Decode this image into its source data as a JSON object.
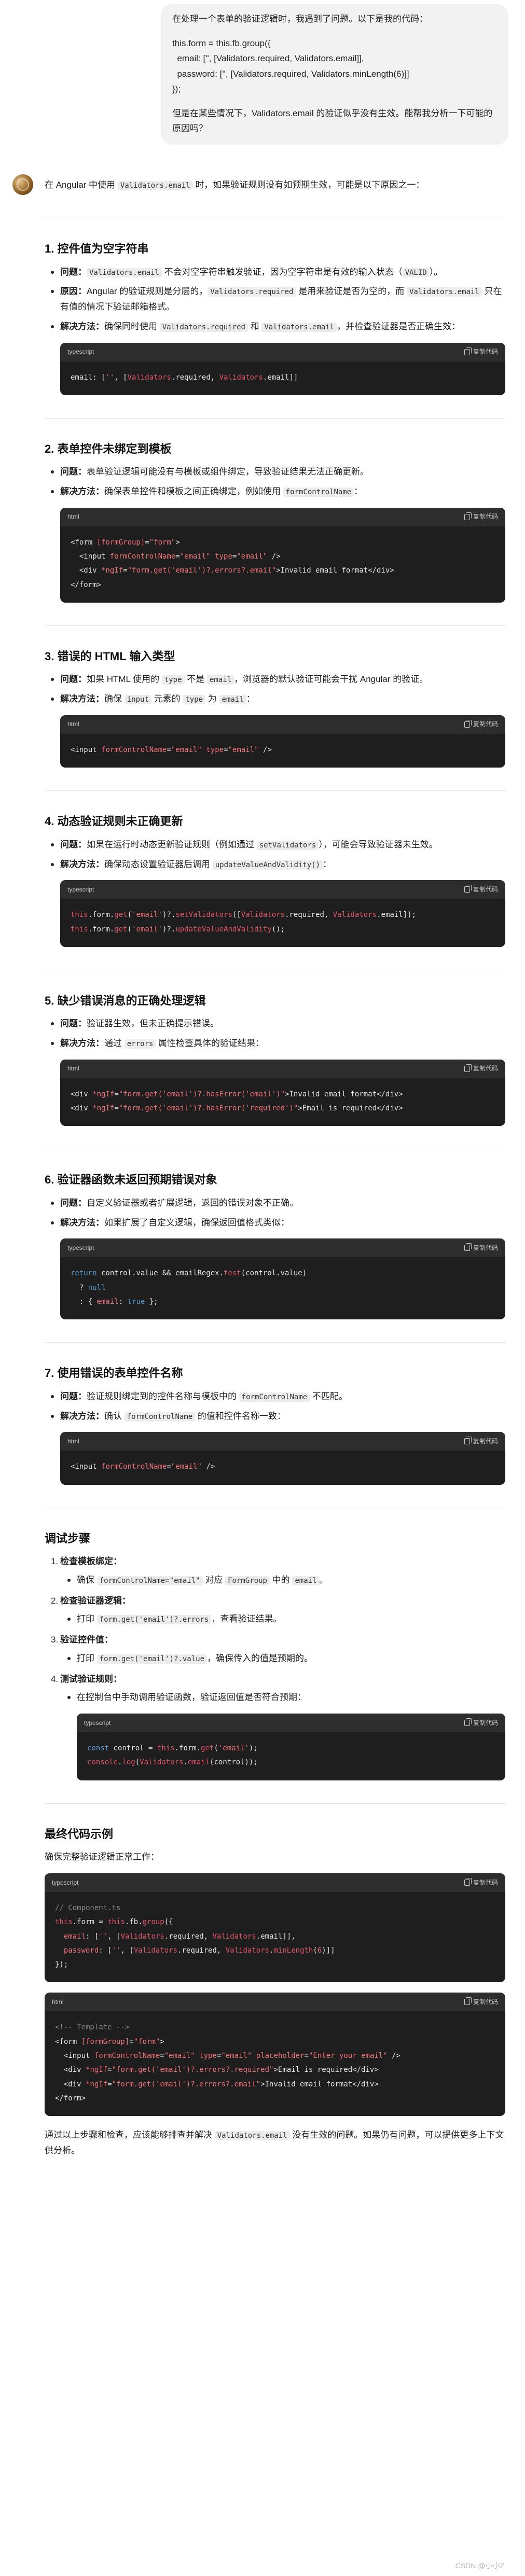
{
  "user_message": {
    "intro": "在处理一个表单的验证逻辑时，我遇到了问题。以下是我的代码：",
    "code_lines": [
      "this.form = this.fb.group({",
      "  email: ['', [Validators.required, Validators.email]],",
      "  password: ['', [Validators.required, Validators.minLength(6)]]",
      "});"
    ],
    "question": "但是在某些情况下，Validators.email 的验证似乎没有生效。能帮我分析一下可能的原因吗？"
  },
  "answer": {
    "intro_prefix": "在 Angular 中使用 ",
    "intro_code": "Validators.email",
    "intro_suffix": " 时，如果验证规则没有如预期生效，可能是以下原因之一：",
    "copy_label": "复制代码",
    "label_problem": "问题",
    "label_reason": "原因",
    "label_solution": "解决方法",
    "sections": {
      "s1": {
        "title": "1. 控件值为空字符串",
        "problem_code": "Validators.email",
        "problem_text": " 不会对空字符串触发验证，因为空字符串是有效的输入状态（",
        "problem_code2": "VALID",
        "problem_text2": "）。",
        "reason_text": "Angular 的验证规则是分层的，",
        "reason_code": "Validators.required",
        "reason_text2": " 是用来验证是否为空的，而 ",
        "reason_code2": "Validators.email",
        "reason_text3": " 只在有值的情况下验证邮箱格式。",
        "solution_text": "确保同时使用 ",
        "solution_code": "Validators.required",
        "solution_text2": " 和 ",
        "solution_code2": "Validators.email",
        "solution_text3": "，并检查验证器是否正确生效：",
        "code_lang": "typescript"
      },
      "s2": {
        "title": "2. 表单控件未绑定到模板",
        "problem_text": "表单验证逻辑可能没有与模板或组件绑定，导致验证结果无法正确更新。",
        "solution_text": "确保表单控件和模板之间正确绑定，例如使用 ",
        "solution_code": "formControlName",
        "solution_text2": "：",
        "code_lang": "html"
      },
      "s3": {
        "title": "3. 错误的 HTML 输入类型",
        "problem_text": "如果 HTML 使用的 ",
        "problem_code": "type",
        "problem_text2": " 不是 ",
        "problem_code2": "email",
        "problem_text3": "，浏览器的默认验证可能会干扰 Angular 的验证。",
        "solution_text": "确保 ",
        "solution_code": "input",
        "solution_text2": " 元素的 ",
        "solution_code2": "type",
        "solution_text3": " 为 ",
        "solution_code3": "email",
        "solution_text4": "：",
        "code_lang": "html"
      },
      "s4": {
        "title": "4. 动态验证规则未正确更新",
        "problem_text": "如果在运行时动态更新验证规则（例如通过 ",
        "problem_code": "setValidators",
        "problem_text2": "），可能会导致验证器未生效。",
        "solution_text": "确保动态设置验证器后调用 ",
        "solution_code": "updateValueAndValidity()",
        "solution_text2": "：",
        "code_lang": "typescript"
      },
      "s5": {
        "title": "5. 缺少错误消息的正确处理逻辑",
        "problem_text": "验证器生效，但未正确提示错误。",
        "solution_text": "通过 ",
        "solution_code": "errors",
        "solution_text2": " 属性检查具体的验证结果：",
        "code_lang": "html"
      },
      "s6": {
        "title": "6. 验证器函数未返回预期错误对象",
        "problem_text": "自定义验证器或者扩展逻辑，返回的错误对象不正确。",
        "solution_text": "如果扩展了自定义逻辑，确保返回值格式类似：",
        "code_lang": "typescript"
      },
      "s7": {
        "title": "7. 使用错误的表单控件名称",
        "problem_text": "验证规则绑定到的控件名称与模板中的 ",
        "problem_code": "formControlName",
        "problem_text2": " 不匹配。",
        "solution_text": "确认 ",
        "solution_code": "formControlName",
        "solution_text2": " 的值和控件名称一致：",
        "code_lang": "html"
      }
    },
    "debug": {
      "title": "调试步骤",
      "items": [
        {
          "num": "1.",
          "title": "检查模板绑定",
          "colon": "：",
          "sub_prefix": "确保 ",
          "sub_code": "formControlName=\"email\"",
          "sub_mid": " 对应 ",
          "sub_code2": "FormGroup",
          "sub_mid2": " 中的 ",
          "sub_code3": "email",
          "sub_suffix": "。"
        },
        {
          "num": "2.",
          "title": "检查验证器逻辑",
          "colon": "：",
          "sub_prefix": "打印 ",
          "sub_code": "form.get('email')?.errors",
          "sub_suffix": "，查看验证结果。"
        },
        {
          "num": "3.",
          "title": "验证控件值",
          "colon": "：",
          "sub_prefix": "打印 ",
          "sub_code": "form.get('email')?.value",
          "sub_suffix": "，确保传入的值是预期的。"
        },
        {
          "num": "4.",
          "title": "测试验证规则",
          "colon": "：",
          "sub_prefix": "在控制台中手动调用验证函数，验证返回值是否符合预期：",
          "code_lang": "typescript"
        }
      ]
    },
    "final": {
      "title": "最终代码示例",
      "intro": "确保完整验证逻辑正常工作：",
      "code_lang_ts": "typescript",
      "code_lang_html": "html",
      "closing": "通过以上步骤和检查，应该能够排查并解决 ",
      "closing_code": "Validators.email",
      "closing2": " 没有生效的问题。如果仍有问题，可以提供更多上下文供分析。"
    }
  },
  "watermark": "CSDN @小小Z",
  "colors": {
    "accent": "#569cd6",
    "string": "#f07178",
    "bubble": "#f2f2f2",
    "code_bg": "#1e1e1e"
  }
}
